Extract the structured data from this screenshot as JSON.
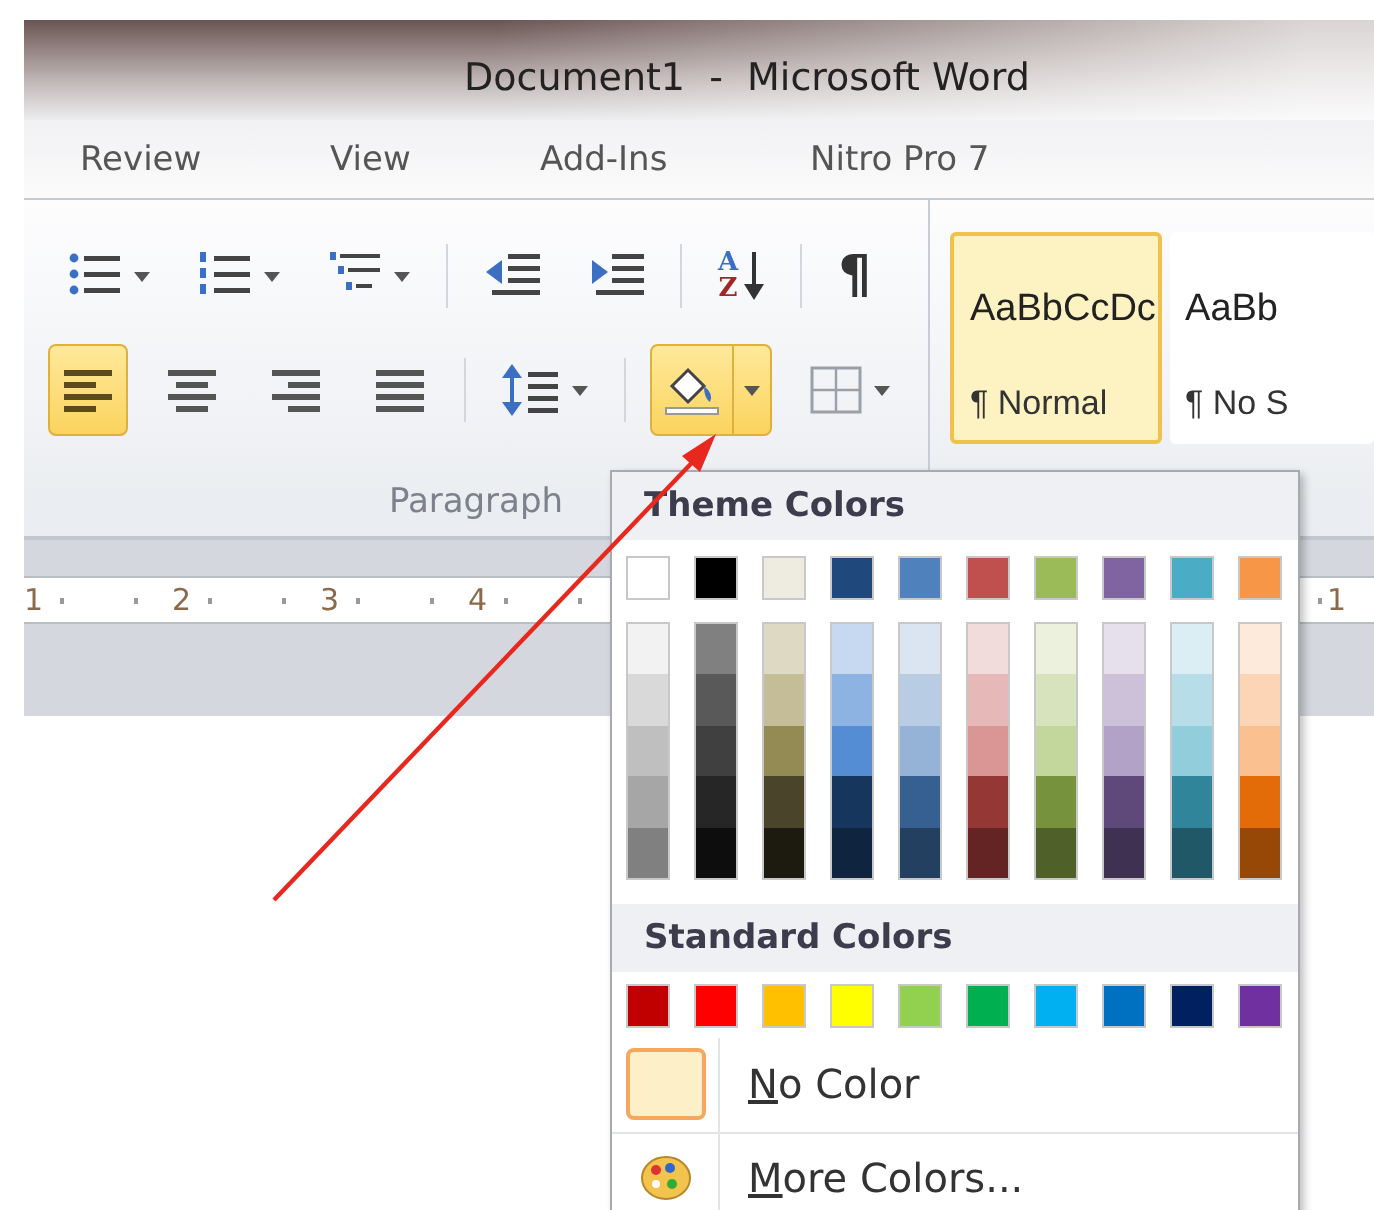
{
  "window": {
    "title": "Document1  -  Microsoft Word"
  },
  "tabs": [
    {
      "label": "Review"
    },
    {
      "label": "View"
    },
    {
      "label": "Add-Ins"
    },
    {
      "label": "Nitro Pro 7"
    }
  ],
  "paragraph": {
    "label": "Paragraph",
    "row_1": [
      {
        "kind": "bullets",
        "dropdown": true
      },
      {
        "kind": "numbering",
        "dropdown": true
      },
      {
        "kind": "multilevel",
        "dropdown": true
      },
      {
        "kind": "separator"
      },
      {
        "kind": "decrease-indent"
      },
      {
        "kind": "increase-indent"
      },
      {
        "kind": "separator"
      },
      {
        "kind": "sort",
        "top": "A",
        "bottom": "Z"
      },
      {
        "kind": "separator"
      },
      {
        "kind": "show-marks",
        "glyph": "¶"
      }
    ],
    "row_2": [
      {
        "kind": "align-left",
        "selected": true
      },
      {
        "kind": "align-center",
        "selected": false
      },
      {
        "kind": "align-right",
        "selected": false
      },
      {
        "kind": "justify",
        "selected": false
      },
      {
        "kind": "separator"
      },
      {
        "kind": "line-spacing",
        "dropdown": true
      },
      {
        "kind": "separator"
      },
      {
        "kind": "shading",
        "dropdown": true,
        "open": true
      },
      {
        "kind": "borders",
        "dropdown": true
      }
    ]
  },
  "styles": [
    {
      "sample": "AaBbCcDc",
      "name": "¶ Normal",
      "selected": true
    },
    {
      "sample": "AaBb",
      "name": "¶ No S",
      "selected": false
    }
  ],
  "ruler": {
    "labels": [
      "1",
      "2",
      "3",
      "4"
    ],
    "right_labels": [
      "1"
    ]
  },
  "color_menu": {
    "theme_header": "Theme Colors",
    "theme_colors": [
      {
        "color": "#ffffff",
        "shades": [
          {
            "color": "#f2f2f2"
          },
          {
            "color": "#d9d9d9"
          },
          {
            "color": "#bfbfbf"
          },
          {
            "color": "#a6a6a6"
          },
          {
            "color": "#808080"
          }
        ]
      },
      {
        "color": "#000000",
        "shades": [
          {
            "color": "#808080"
          },
          {
            "color": "#595959"
          },
          {
            "color": "#404040"
          },
          {
            "color": "#262626"
          },
          {
            "color": "#0d0d0d"
          }
        ]
      },
      {
        "color": "#eeece1",
        "shades": [
          {
            "color": "#ddd9c3"
          },
          {
            "color": "#c4bd97"
          },
          {
            "color": "#948a54"
          },
          {
            "color": "#4a452a"
          },
          {
            "color": "#1d1b10"
          }
        ]
      },
      {
        "color": "#1f497d",
        "shades": [
          {
            "color": "#c6d9f1"
          },
          {
            "color": "#8db3e2"
          },
          {
            "color": "#548dd4"
          },
          {
            "color": "#17365d"
          },
          {
            "color": "#0f243e"
          }
        ]
      },
      {
        "color": "#4f81bd",
        "shades": [
          {
            "color": "#dbe5f1"
          },
          {
            "color": "#b8cce4"
          },
          {
            "color": "#95b3d7"
          },
          {
            "color": "#366092"
          },
          {
            "color": "#244061"
          }
        ]
      },
      {
        "color": "#c0504d",
        "shades": [
          {
            "color": "#f2dcdb"
          },
          {
            "color": "#e6b9b8"
          },
          {
            "color": "#d99694"
          },
          {
            "color": "#953734"
          },
          {
            "color": "#632423"
          }
        ]
      },
      {
        "color": "#9bbb59",
        "shades": [
          {
            "color": "#ebf1dd"
          },
          {
            "color": "#d7e3bc"
          },
          {
            "color": "#c3d69b"
          },
          {
            "color": "#76923c"
          },
          {
            "color": "#4f6128"
          }
        ]
      },
      {
        "color": "#8064a2",
        "shades": [
          {
            "color": "#e5e0ec"
          },
          {
            "color": "#ccc1d9"
          },
          {
            "color": "#b2a2c7"
          },
          {
            "color": "#5f497a"
          },
          {
            "color": "#3f3151"
          }
        ]
      },
      {
        "color": "#4bacc6",
        "shades": [
          {
            "color": "#dbeef3"
          },
          {
            "color": "#b7dde8"
          },
          {
            "color": "#92cddc"
          },
          {
            "color": "#31859b"
          },
          {
            "color": "#205867"
          }
        ]
      },
      {
        "color": "#f79646",
        "shades": [
          {
            "color": "#fdeada"
          },
          {
            "color": "#fbd5b5"
          },
          {
            "color": "#fac08f"
          },
          {
            "color": "#e36c09"
          },
          {
            "color": "#974806"
          }
        ]
      }
    ],
    "standard_header": "Standard Colors",
    "standard_colors": [
      {
        "color": "#c00000"
      },
      {
        "color": "#ff0000"
      },
      {
        "color": "#ffc000"
      },
      {
        "color": "#ffff00"
      },
      {
        "color": "#92d050"
      },
      {
        "color": "#00b050"
      },
      {
        "color": "#00b0f0"
      },
      {
        "color": "#0070c0"
      },
      {
        "color": "#002060"
      },
      {
        "color": "#7030a0"
      }
    ],
    "no_color": {
      "label": "No Color",
      "selected": true
    },
    "more_colors": {
      "label": "More Colors..."
    }
  }
}
